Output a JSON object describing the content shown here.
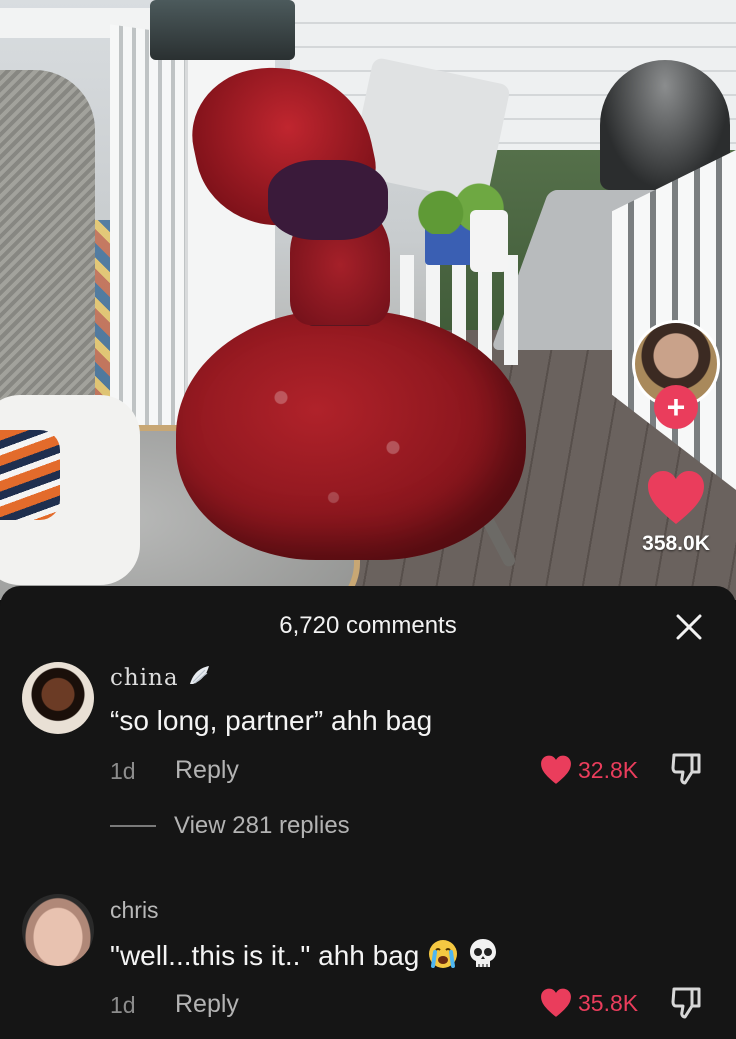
{
  "video": {
    "like_count": "358.0K"
  },
  "comments_panel": {
    "title": "6,720 comments",
    "comments": [
      {
        "username": "china",
        "username_badge_icon": "wing-icon",
        "text": "“so long, partner” ahh bag",
        "time": "1d",
        "reply_label": "Reply",
        "likes": "32.8K",
        "view_replies": "View 281 replies"
      },
      {
        "username": "chris",
        "text": "\"well...this is it..\" ahh bag",
        "emoji": [
          "crying-face-icon",
          "skull-icon"
        ],
        "time": "1d",
        "reply_label": "Reply",
        "likes": "35.8K"
      }
    ]
  },
  "colors": {
    "accent_red": "#ea3d5c",
    "panel_bg": "#151515"
  }
}
